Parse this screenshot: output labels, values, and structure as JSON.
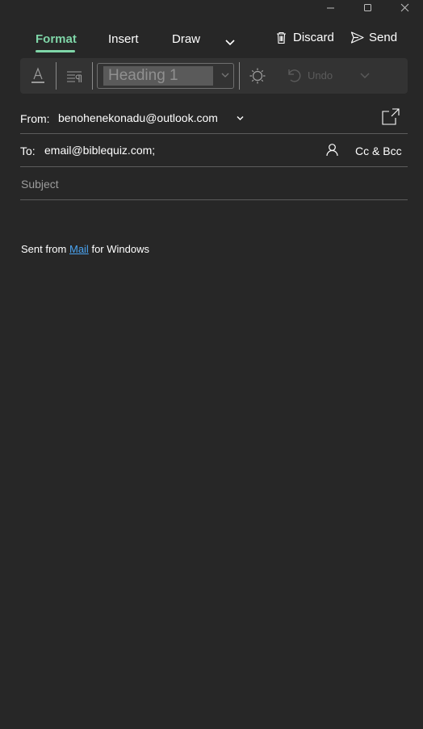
{
  "window": {
    "controls": [
      "minimize-icon",
      "maximize-icon",
      "close-icon"
    ]
  },
  "tabs": [
    {
      "label": "Format",
      "active": true
    },
    {
      "label": "Insert",
      "active": false
    },
    {
      "label": "Draw",
      "active": false
    }
  ],
  "actions": {
    "discard_label": "Discard",
    "send_label": "Send"
  },
  "toolbar": {
    "style_value": "Heading 1",
    "undo_label": "Undo"
  },
  "from": {
    "label": "From:",
    "value": "benohenekonadu@outlook.com"
  },
  "to": {
    "label": "To:",
    "value": "email@biblequiz.com;",
    "ccbcc_label": "Cc & Bcc"
  },
  "subject": {
    "placeholder": "Subject"
  },
  "signature": {
    "prefix": "Sent from",
    "link": "Mail",
    "suffix": "for Windows"
  },
  "colors": {
    "background": "#272727",
    "accent": "#7fd6a8",
    "link": "#4aa3f0"
  }
}
